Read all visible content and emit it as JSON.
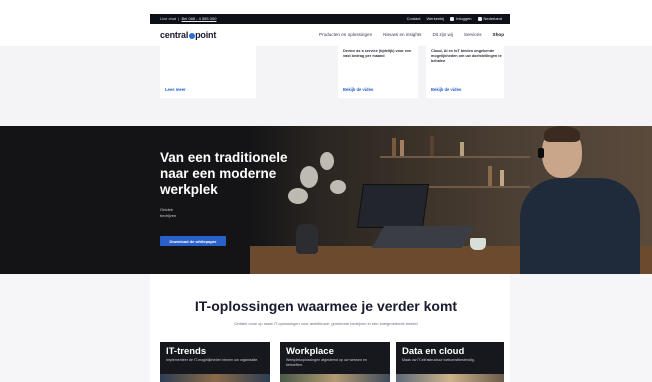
{
  "topbar": {
    "left_text": "Live chat",
    "phone": "Bel 088 - 4 555 000",
    "items": [
      "Contact",
      "Werkenbij",
      "Inloggen",
      "Nederland"
    ]
  },
  "nav": {
    "logo_left": "central",
    "logo_right": "point",
    "items": [
      "Producten en oplossingen",
      "Nieuws en insights",
      "Dit zijn wij",
      "Services"
    ],
    "shop": "Shop"
  },
  "cards": [
    {
      "text": "",
      "link": "Lees meer"
    },
    {
      "text": "Device as a service (tijdelijk) voor een vast bedrag per maand",
      "link": "Bekijk de video"
    },
    {
      "text": "Cloud, AI en IoT bieden ongekende mogelijkheden om uw doelstellingen te behalen",
      "link": "Bekijk de video"
    }
  ],
  "hero": {
    "title": "Van een traditionele naar een moderne werkplek",
    "sub_line1": "Ontdek",
    "sub_line2": "bedrijven",
    "button": "Download de whitepaper"
  },
  "section": {
    "title": "IT-oplossingen waarmee je verder komt",
    "subtitle": "Ontdek onze op maat IT-oplossingen voor ambitieuze, groeiende bedrijven in een snelgroeiende wereld"
  },
  "tiles": [
    {
      "title": "IT-trends",
      "desc": "Implementeer de IT-mogelijkheden binnen uw organisatie."
    },
    {
      "title": "Workplace",
      "desc": "Werkplekoplossingen afgestemd op uw wensen en behoeften."
    },
    {
      "title": "Data en cloud",
      "desc": "Maak uw IT-infrastructuur toekomstbestendig."
    }
  ],
  "colors": {
    "accent": "#2a62c9",
    "topbar": "#0e1018",
    "hero_bg": "#141416"
  }
}
